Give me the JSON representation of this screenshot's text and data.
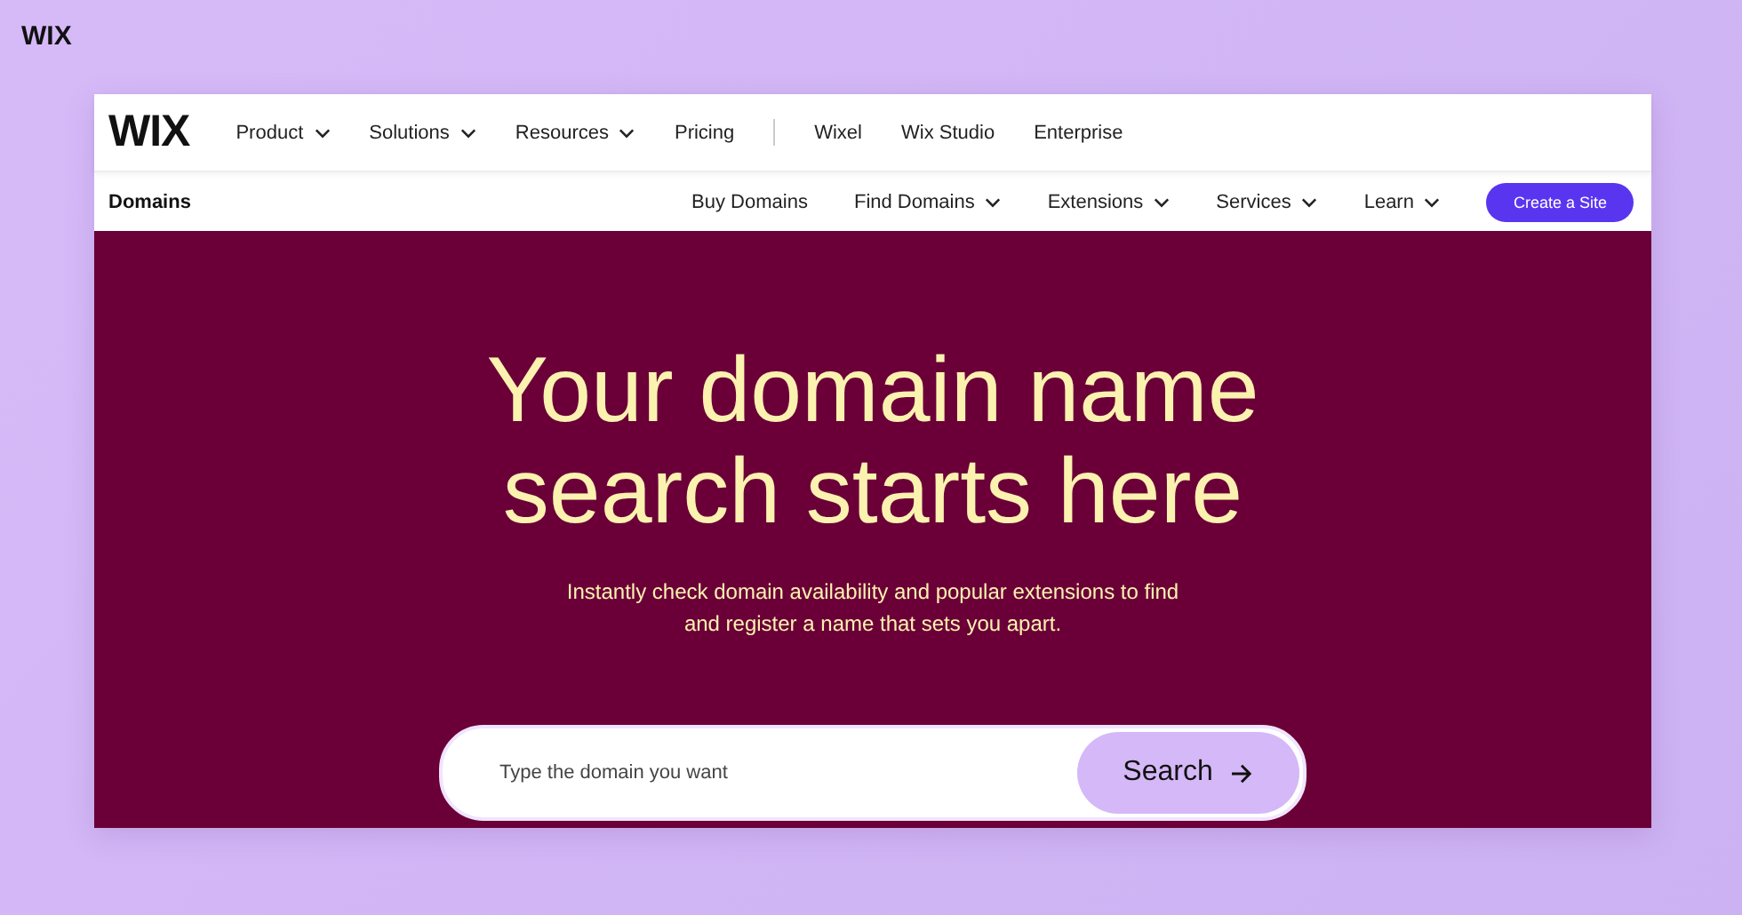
{
  "corner_logo": "WIX",
  "top_nav": {
    "logo": "WIX",
    "main_links": [
      {
        "label": "Product",
        "has_menu": true
      },
      {
        "label": "Solutions",
        "has_menu": true
      },
      {
        "label": "Resources",
        "has_menu": true
      },
      {
        "label": "Pricing",
        "has_menu": false
      }
    ],
    "secondary_links": [
      {
        "label": "Wixel",
        "has_menu": false
      },
      {
        "label": "Wix Studio",
        "has_menu": false
      },
      {
        "label": "Enterprise",
        "has_menu": false
      }
    ]
  },
  "sub_nav": {
    "title": "Domains",
    "links": [
      {
        "label": "Buy Domains",
        "has_menu": false
      },
      {
        "label": "Find Domains",
        "has_menu": true
      },
      {
        "label": "Extensions",
        "has_menu": true
      },
      {
        "label": "Services",
        "has_menu": true
      },
      {
        "label": "Learn",
        "has_menu": true
      }
    ],
    "cta": "Create a Site"
  },
  "hero": {
    "heading": "Your domain name search starts here",
    "subtitle": "Instantly check domain availability and popular extensions to find and register a name that sets you apart.",
    "search": {
      "placeholder": "Type the domain you want",
      "button": "Search"
    }
  }
}
